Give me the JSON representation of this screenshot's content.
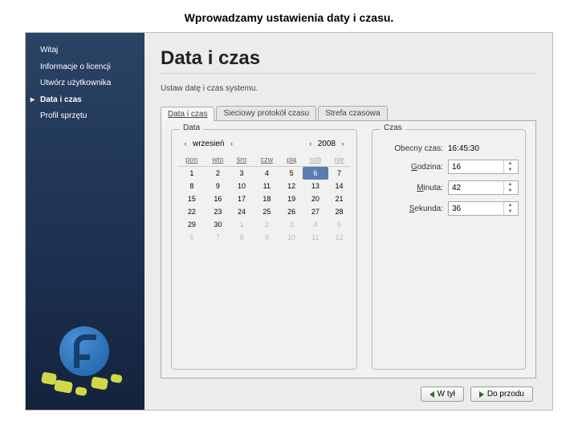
{
  "caption": "Wprowadzamy ustawienia daty i czasu.",
  "sidebar": {
    "items": [
      {
        "label": "Witaj"
      },
      {
        "label": "Informacje o licencji"
      },
      {
        "label": "Utwórz użytkownika"
      },
      {
        "label": "Data i czas"
      },
      {
        "label": "Profil sprzętu"
      }
    ],
    "active_index": 3
  },
  "header": {
    "title": "Data i czas",
    "subtitle": "Ustaw datę i czas systemu."
  },
  "tabs": [
    {
      "label": "Data i czas"
    },
    {
      "label": "Sieciowy protokół czasu"
    },
    {
      "label": "Strefa czasowa"
    }
  ],
  "active_tab": 0,
  "date_panel": {
    "group_label": "Data",
    "month": "wrzesień",
    "year": "2008",
    "day_headers": [
      "pon",
      "wto",
      "śro",
      "czw",
      "pią",
      "sob",
      "nie"
    ],
    "weeks": [
      [
        {
          "n": 1
        },
        {
          "n": 2
        },
        {
          "n": 3
        },
        {
          "n": 4
        },
        {
          "n": 5
        },
        {
          "n": 6,
          "sel": true
        },
        {
          "n": 7
        }
      ],
      [
        {
          "n": 8
        },
        {
          "n": 9
        },
        {
          "n": 10
        },
        {
          "n": 11
        },
        {
          "n": 12
        },
        {
          "n": 13
        },
        {
          "n": 14
        }
      ],
      [
        {
          "n": 15
        },
        {
          "n": 16
        },
        {
          "n": 17
        },
        {
          "n": 18
        },
        {
          "n": 19
        },
        {
          "n": 20
        },
        {
          "n": 21
        }
      ],
      [
        {
          "n": 22
        },
        {
          "n": 23
        },
        {
          "n": 24
        },
        {
          "n": 25
        },
        {
          "n": 26
        },
        {
          "n": 27
        },
        {
          "n": 28
        }
      ],
      [
        {
          "n": 29
        },
        {
          "n": 30
        },
        {
          "n": 1,
          "o": true
        },
        {
          "n": 2,
          "o": true
        },
        {
          "n": 3,
          "o": true
        },
        {
          "n": 4,
          "o": true
        },
        {
          "n": 5,
          "o": true
        }
      ],
      [
        {
          "n": 6,
          "o": true
        },
        {
          "n": 7,
          "o": true
        },
        {
          "n": 8,
          "o": true
        },
        {
          "n": 9,
          "o": true
        },
        {
          "n": 10,
          "o": true
        },
        {
          "n": 11,
          "o": true
        },
        {
          "n": 12,
          "o": true
        }
      ]
    ]
  },
  "time_panel": {
    "group_label": "Czas",
    "current_label": "Obecny czas:",
    "current_value": "16:45:30",
    "hour_label": "Godzina:",
    "hour_value": "16",
    "minute_label": "Minuta:",
    "minute_value": "42",
    "second_label": "Sekunda:",
    "second_value": "36"
  },
  "footer": {
    "back": "W tył",
    "forward": "Do przodu"
  },
  "nav_glyphs": {
    "prev": "‹",
    "next": "›"
  }
}
